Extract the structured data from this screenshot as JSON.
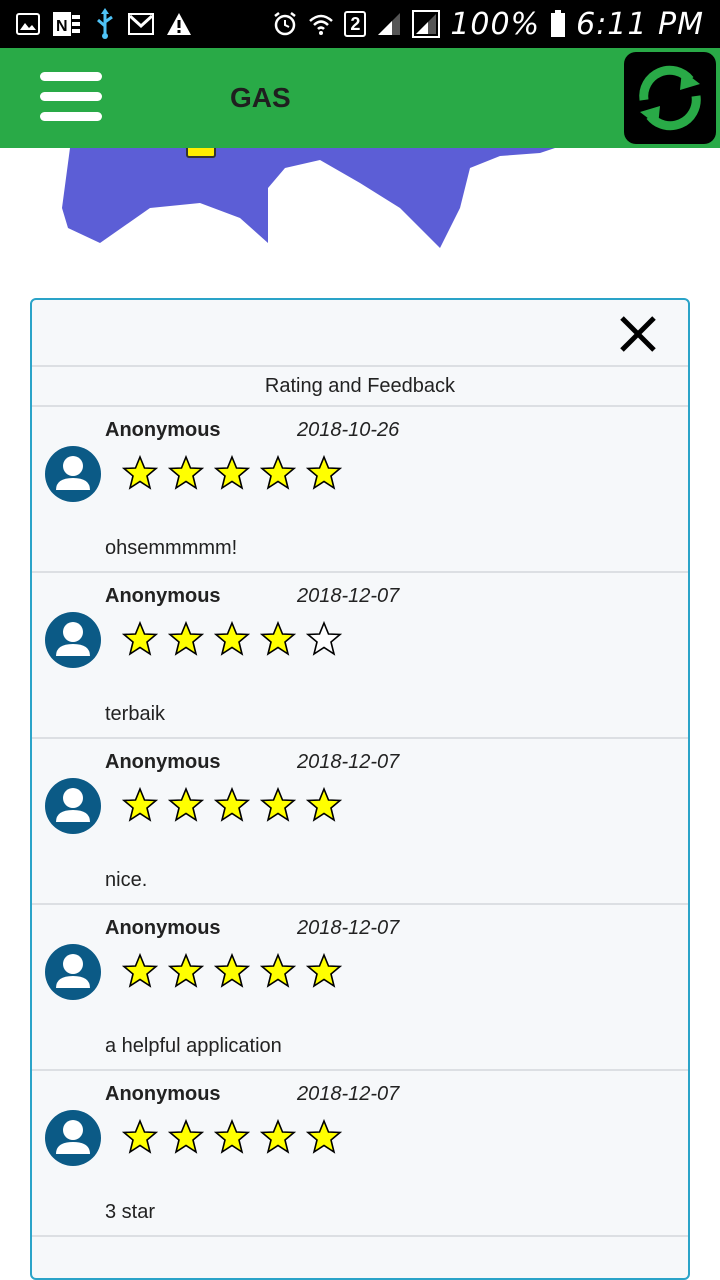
{
  "status_bar": {
    "battery": "100%",
    "time": "6:11 PM",
    "sim_badge": "2",
    "icons": [
      "image-icon",
      "onenote-icon",
      "usb-icon",
      "gmail-icon",
      "warning-icon",
      "alarm-icon",
      "wifi-icon",
      "signal-icon",
      "signal-box-icon",
      "battery-icon"
    ]
  },
  "app_bar": {
    "title": "GAS",
    "menu_icon": "hamburger-menu-icon",
    "refresh_icon": "refresh-icon",
    "color": "#29aa47"
  },
  "map": {
    "region_color": "#5c5ed6",
    "marker_color": "#ffee00"
  },
  "panel": {
    "header": "Rating and Feedback",
    "close_icon": "close-icon",
    "border_color": "#2aa3c8",
    "reviews": [
      {
        "name": "Anonymous",
        "date": "2018-10-26",
        "rating": 5,
        "comment": "ohsemmmmm!"
      },
      {
        "name": "Anonymous",
        "date": "2018-12-07",
        "rating": 4,
        "comment": "terbaik"
      },
      {
        "name": "Anonymous",
        "date": "2018-12-07",
        "rating": 5,
        "comment": "nice."
      },
      {
        "name": "Anonymous",
        "date": "2018-12-07",
        "rating": 5,
        "comment": "a helpful application"
      },
      {
        "name": "Anonymous",
        "date": "2018-12-07",
        "rating": 5,
        "comment": "3 star"
      }
    ]
  },
  "colors": {
    "avatar": "#0b5a86",
    "star_filled": "#ffff00"
  }
}
